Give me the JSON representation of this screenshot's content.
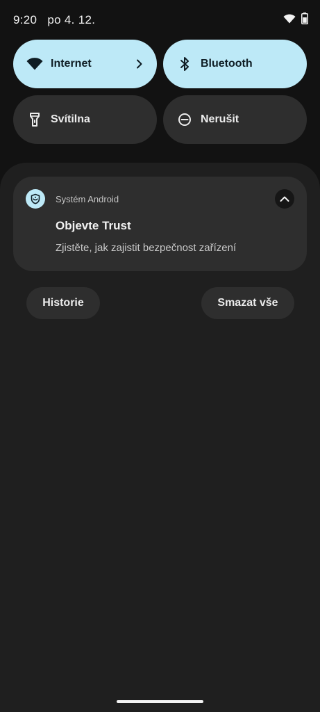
{
  "status_bar": {
    "time": "9:20",
    "date": "po 4. 12.",
    "icons": [
      "wifi-icon",
      "battery-icon"
    ]
  },
  "quick_settings": {
    "tiles": [
      {
        "label": "Internet",
        "icon": "wifi-icon",
        "state": "active",
        "has_chevron": true
      },
      {
        "label": "Bluetooth",
        "icon": "bluetooth-icon",
        "state": "active"
      },
      {
        "label": "Svítilna",
        "icon": "flashlight-icon",
        "state": "inactive"
      },
      {
        "label": "Nerušit",
        "icon": "do-not-disturb-icon",
        "state": "inactive"
      }
    ]
  },
  "notification": {
    "app_name": "Systém Android",
    "app_icon": "android-system-icon",
    "title": "Objevte Trust",
    "text": "Zjistěte, jak zajistit bezpečnost zařízení",
    "expand_icon": "chevron-up-icon"
  },
  "actions": {
    "history_label": "Historie",
    "clear_all_label": "Smazat vše"
  },
  "colors": {
    "background": "#121212",
    "panel": "#1f1f1f",
    "tile_active": "#bde9f7",
    "tile_inactive": "#2e2e2e"
  }
}
